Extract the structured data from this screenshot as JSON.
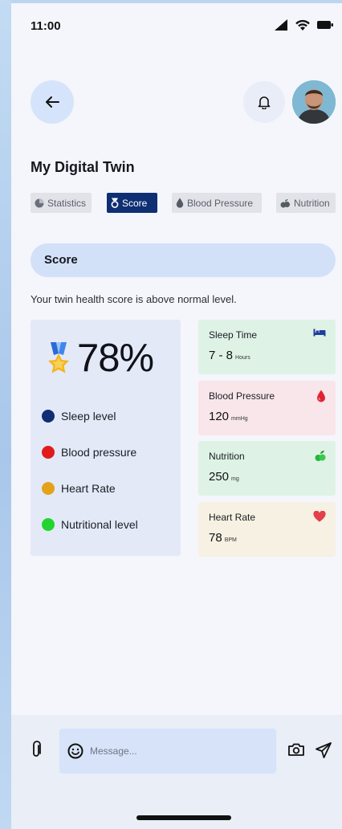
{
  "status_bar": {
    "time": "11:00"
  },
  "header": {
    "title": "My Digital Twin"
  },
  "tabs": [
    {
      "label": "Statistics",
      "icon": "pie-chart-icon",
      "active": false
    },
    {
      "label": "Score",
      "icon": "medal-icon",
      "active": true
    },
    {
      "label": "Blood Pressure",
      "icon": "drop-icon",
      "active": false
    },
    {
      "label": "Nutrition",
      "icon": "nutrition-icon",
      "active": false
    }
  ],
  "section": {
    "title": "Score"
  },
  "subtitle": "Your twin health score is above normal level.",
  "score": {
    "value": "78%",
    "legend": [
      {
        "label": "Sleep level",
        "color": "#0f2f73"
      },
      {
        "label": "Blood pressure",
        "color": "#e01b1b"
      },
      {
        "label": "Heart Rate",
        "color": "#e3a21a"
      },
      {
        "label": "Nutritional level",
        "color": "#23d42f"
      }
    ]
  },
  "metrics": [
    {
      "label": "Sleep Time",
      "value": "7 - 8",
      "unit": "Hours",
      "icon": "bed-icon",
      "bg": "#dff2e6"
    },
    {
      "label": "Blood Pressure",
      "value": "120",
      "unit": "mmHg",
      "icon": "blood-drop-icon",
      "bg": "#f9e6ea"
    },
    {
      "label": "Nutrition",
      "value": "250",
      "unit": "mg",
      "icon": "leaf-icon",
      "bg": "#dff2e6"
    },
    {
      "label": "Heart Rate",
      "value": "78",
      "unit": "BPM",
      "icon": "heart-icon",
      "bg": "#f6f1e3"
    }
  ],
  "composer": {
    "placeholder": "Message..."
  },
  "colors": {
    "accent": "#0f2f73",
    "section_bg": "#d3e1f8"
  }
}
